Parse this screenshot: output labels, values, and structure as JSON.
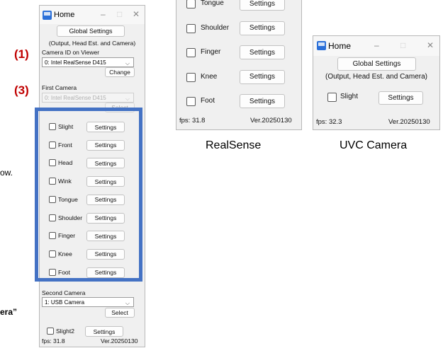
{
  "left_window": {
    "title": "Home",
    "global_button": "Global Settings",
    "global_desc": "(Output, Head Est. and Camera)",
    "camera_id_label": "Camera ID on Viewer",
    "camera_id_value": "0: Intel RealSense D415",
    "change_button": "Change",
    "first_camera_label": "First Camera",
    "first_camera_value": "0: Intel RealSense D415",
    "select_button": "Select",
    "items": [
      "Slight",
      "Front",
      "Head",
      "Wink",
      "Tongue",
      "Shoulder",
      "Finger",
      "Knee",
      "Foot"
    ],
    "settings_label": "Settings",
    "second_camera_label": "Second Camera",
    "second_camera_value": "1: USB Camera",
    "second_select_button": "Select",
    "slight2_label": "Slight2",
    "fps": "fps: 31.8",
    "version": "Ver.20250130"
  },
  "annotations": {
    "label1": "(1)",
    "label3": "(3)",
    "frag_ow": "ow.",
    "frag_era": "era”"
  },
  "realsense_window": {
    "items": [
      "Tongue",
      "Shoulder",
      "Finger",
      "Knee",
      "Foot"
    ],
    "settings_label": "Settings",
    "fps": "fps: 31.8",
    "version": "Ver.20250130",
    "caption": "RealSense"
  },
  "uvc_window": {
    "title": "Home",
    "global_button": "Global Settings",
    "global_desc": "(Output, Head Est. and Camera)",
    "slight_label": "Slight",
    "settings_label": "Settings",
    "fps": "fps: 32.3",
    "version": "Ver.20250130",
    "caption": "UVC Camera"
  }
}
